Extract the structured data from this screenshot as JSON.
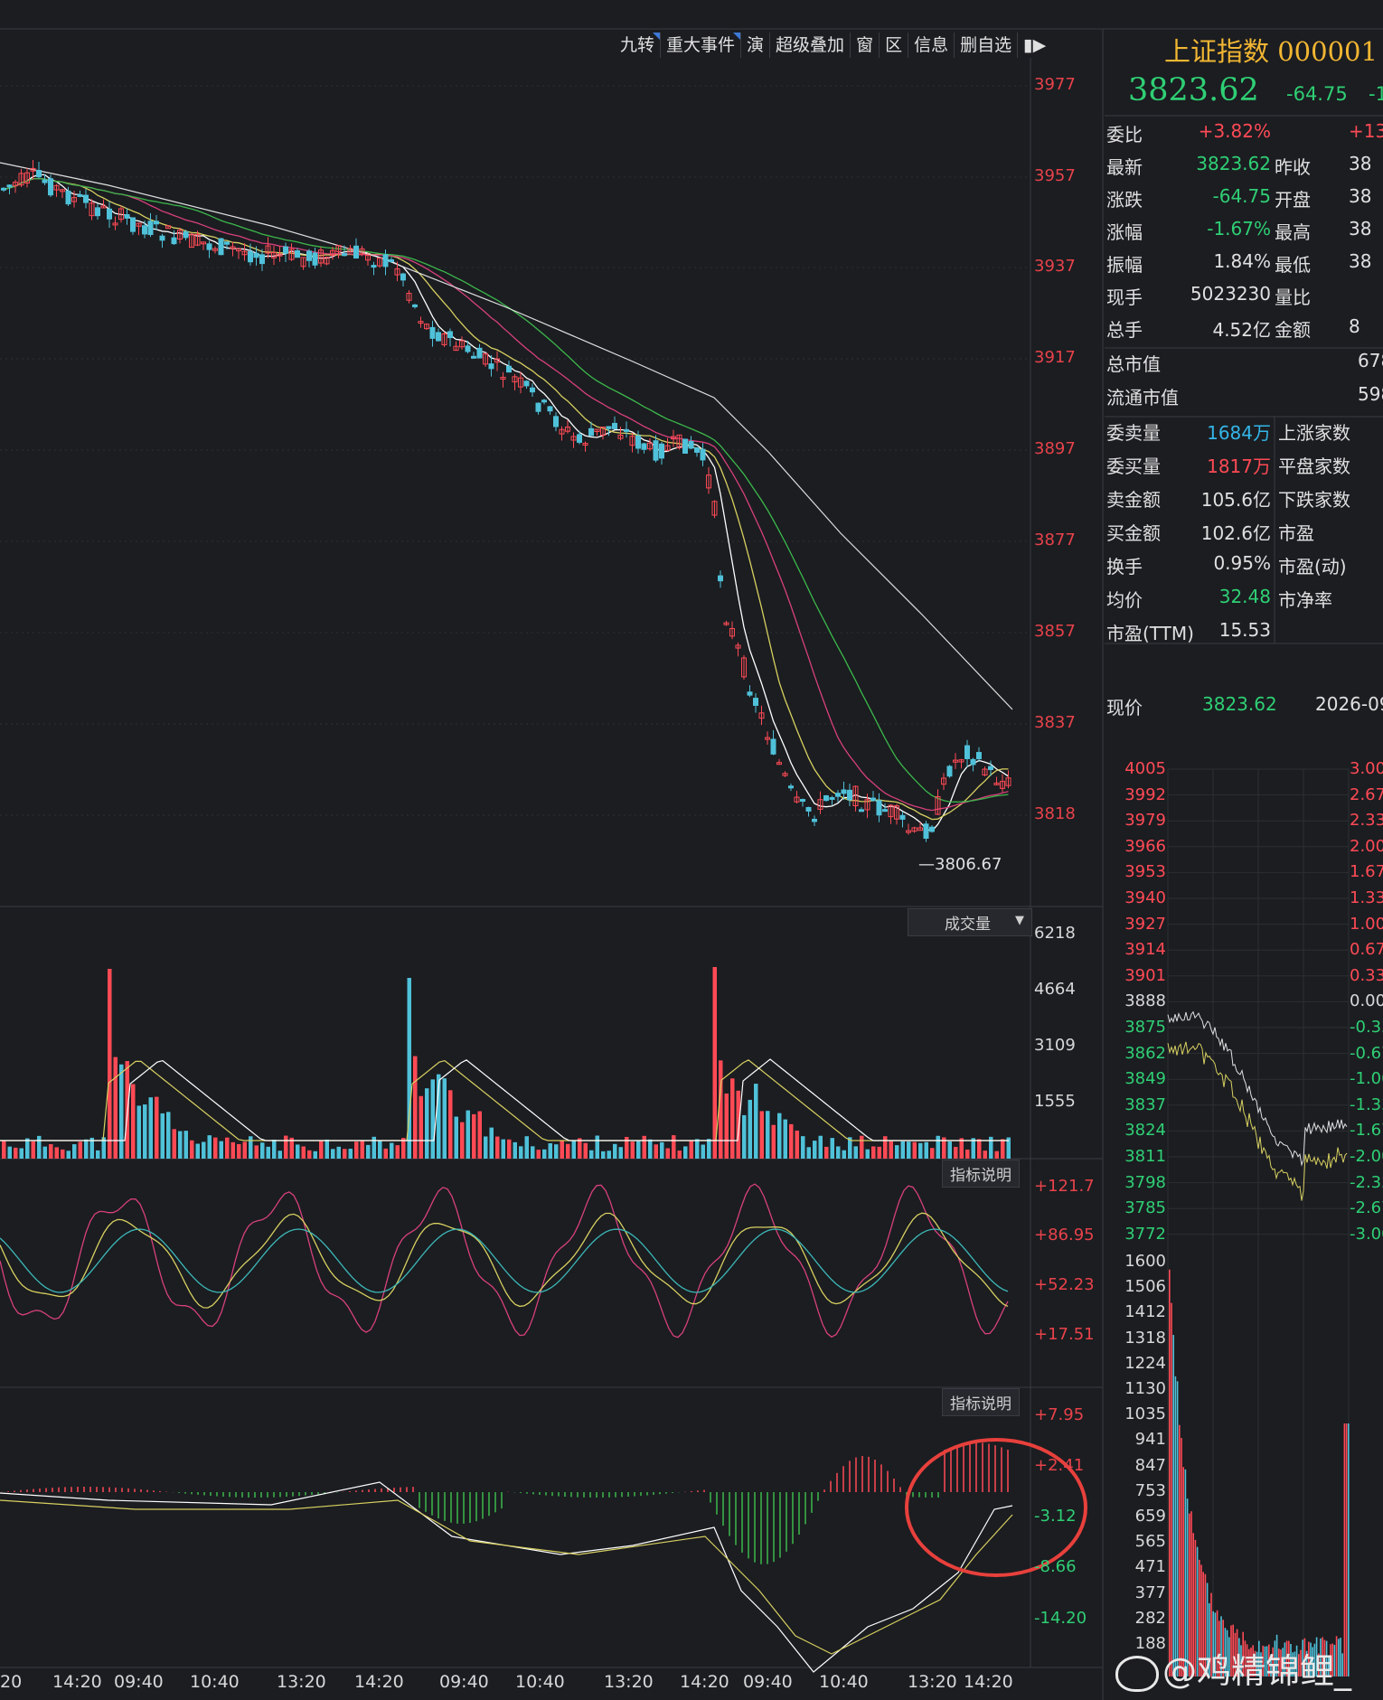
{
  "toolbar": {
    "items": [
      "九转",
      "重大事件",
      "演",
      "超级叠加",
      "窗",
      "区",
      "信息",
      "删自选"
    ],
    "end_icon": "collapse-right-icon"
  },
  "header": {
    "name": "上证指数",
    "code": "000001",
    "price": "3823.62",
    "change": "-64.75",
    "pct_partial": "-1"
  },
  "quote": {
    "rows": [
      {
        "label": "委比",
        "value": "+3.82%",
        "right_label": "",
        "right_value": "+13"
      },
      {
        "label": "最新",
        "value": "3823.62",
        "right_label": "昨收",
        "right_value": "38"
      },
      {
        "label": "涨跌",
        "value": "-64.75",
        "right_label": "开盘",
        "right_value": "38"
      },
      {
        "label": "涨幅",
        "value": "-1.67%",
        "right_label": "最高",
        "right_value": "38"
      },
      {
        "label": "振幅",
        "value": "1.84%",
        "right_label": "最低",
        "right_value": "38"
      },
      {
        "label": "现手",
        "value": "5023230",
        "right_label": "量比",
        "right_value": ""
      },
      {
        "label": "总手",
        "value": "4.52亿",
        "right_label": "金额",
        "right_value": "8"
      }
    ],
    "market_cap_label": "总市值",
    "market_cap_value": "678",
    "float_cap_label": "流通市值",
    "float_cap_value": "598",
    "detail_rows": [
      {
        "label": "委卖量",
        "value": "1684万",
        "right_label": "上涨家数"
      },
      {
        "label": "委买量",
        "value": "1817万",
        "right_label": "平盘家数"
      },
      {
        "label": "卖金额",
        "value": "105.6亿",
        "right_label": "下跌家数"
      },
      {
        "label": "买金额",
        "value": "102.6亿",
        "right_label": "市盈"
      },
      {
        "label": "换手",
        "value": "0.95%",
        "right_label": "市盈(动)"
      },
      {
        "label": "均价",
        "value": "32.48",
        "right_label": "市净率"
      },
      {
        "label": "市盈(TTM)",
        "value": "15.53",
        "right_label": ""
      }
    ],
    "current_label": "现价",
    "current_value": "3823.62",
    "date_partial": "2026-09"
  },
  "mini_chart": {
    "price_ticks": [
      "4005",
      "3992",
      "3979",
      "3966",
      "3953",
      "3940",
      "3927",
      "3914",
      "3901",
      "3888",
      "3875",
      "3862",
      "3849",
      "3837",
      "3824",
      "3811",
      "3798",
      "3785",
      "3772"
    ],
    "pct_ticks": [
      "3.00",
      "2.67",
      "2.33",
      "2.00",
      "1.67",
      "1.33",
      "1.00",
      "0.67",
      "0.33",
      "0.00",
      "-0.33",
      "-0.67",
      "-1.00",
      "-1.33",
      "-1.67",
      "-2.00",
      "-2.33",
      "-2.67",
      "-3.00"
    ],
    "vol_ticks": [
      "1600",
      "1506",
      "1412",
      "1318",
      "1224",
      "1130",
      "1035",
      "941",
      "847",
      "753",
      "659",
      "565",
      "471",
      "377",
      "282",
      "188"
    ]
  },
  "main_chart": {
    "price_ticks": [
      "3977",
      "3957",
      "3937",
      "3917",
      "3897",
      "3877",
      "3857",
      "3837",
      "3818"
    ],
    "low_marker": "3806.67",
    "volume_label": "成交量",
    "volume_ticks": [
      "6218",
      "4664",
      "3109",
      "1555"
    ],
    "ind1_label": "指标说明",
    "ind1_ticks": [
      "+121.7",
      "+86.95",
      "+52.23",
      "+17.51"
    ],
    "ind2_label": "指标说明",
    "ind2_ticks": [
      "+7.95",
      "+2.41",
      "-3.12",
      "-8.66",
      "-14.20"
    ],
    "time_ticks": [
      "20",
      "14:20",
      "09:40",
      "10:40",
      "13:20",
      "14:20",
      "09:40",
      "10:40",
      "13:20",
      "14:20",
      "09:40",
      "10:40",
      "13:20",
      "14:20"
    ]
  },
  "watermark": "@鸡精锦鲤_",
  "colors": {
    "up": "#ff4a55",
    "down": "#2fcf74",
    "candle_down": "#4fc1d9",
    "bg": "#1b1d21",
    "circle": "#e8403c"
  }
}
